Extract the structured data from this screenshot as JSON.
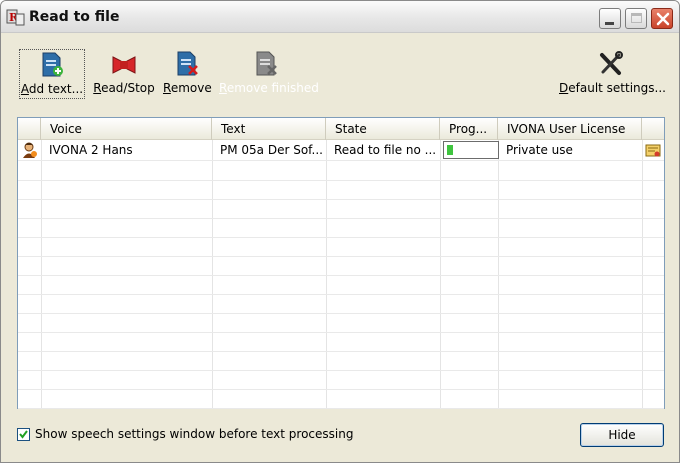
{
  "window": {
    "title": "Read to file"
  },
  "toolbar": {
    "add_text": "Add text...",
    "read_stop": "Read/Stop",
    "remove": "Remove",
    "remove_finished": "Remove finished",
    "default_settings": "Default settings..."
  },
  "table": {
    "columns": [
      "Voice",
      "Text",
      "State",
      "Prog...",
      "IVONA User License"
    ],
    "rows": [
      {
        "voice": "IVONA 2 Hans",
        "text": "PM 05a Der Sof...",
        "state": "Read to file no ...",
        "progress": 0.12,
        "license": "Private use"
      }
    ]
  },
  "footer": {
    "show_settings_label": "Show speech settings window before text processing",
    "show_settings_checked": true,
    "hide_button": "Hide"
  },
  "colors": {
    "progress_fill": "#3fc43f",
    "grid_border": "#7f9db9",
    "window_bg": "#ece9d8"
  },
  "icons": {
    "app": "ivona-app-icon",
    "add_text": "add-document-icon",
    "read_stop": "read-stop-icon",
    "remove": "remove-document-icon",
    "remove_finished": "remove-finished-icon",
    "default_settings": "tools-icon",
    "voice_row": "person-icon",
    "license_row": "license-certificate-icon"
  }
}
